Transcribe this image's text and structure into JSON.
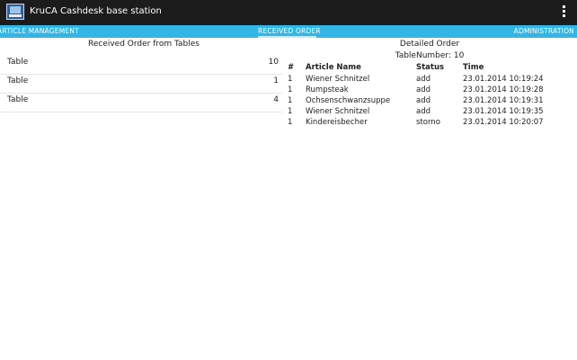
{
  "app": {
    "title": "KruCA Cashdesk base station",
    "icon": "cashdesk-icon",
    "menu_icon": "overflow-menu-icon"
  },
  "tabs": [
    {
      "label": "ARTICLE MANAGEMENT"
    },
    {
      "label": "RECEIVED ORDER"
    },
    {
      "label": "ADMINISTRATION"
    }
  ],
  "colors": {
    "actionbar": "#1c1c1c",
    "tabbar": "#33b5e5"
  },
  "left": {
    "title": "Received Order from Tables",
    "rows": [
      {
        "label": "Table",
        "count": "10"
      },
      {
        "label": "Table",
        "count": "1"
      },
      {
        "label": "Table",
        "count": "4"
      }
    ]
  },
  "right": {
    "title": "Detailed Order",
    "table_number": "TableNumber: 10",
    "headers": {
      "num": "#",
      "name": "Article Name",
      "status": "Status",
      "time": "Time"
    },
    "rows": [
      {
        "num": "1",
        "name": "Wiener Schnitzel",
        "status": "add",
        "time": "23.01.2014 10:19:24"
      },
      {
        "num": "1",
        "name": "Rumpsteak",
        "status": "add",
        "time": "23.01.2014 10:19:28"
      },
      {
        "num": "1",
        "name": "Ochsenschwanzsuppe",
        "status": "add",
        "time": "23.01.2014 10:19:31"
      },
      {
        "num": "1",
        "name": "Wiener Schnitzel",
        "status": "add",
        "time": "23.01.2014 10:19:35"
      },
      {
        "num": "1",
        "name": "Kindereisbecher",
        "status": "storno",
        "time": "23.01.2014 10:20:07"
      }
    ]
  }
}
